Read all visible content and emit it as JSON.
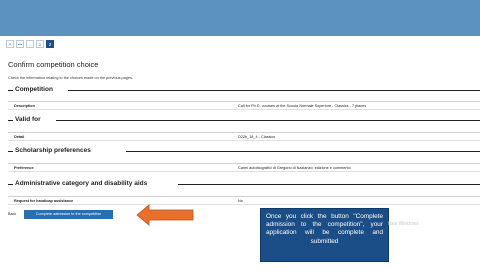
{
  "stepper": {
    "steps": [
      "A",
      "•••",
      "...",
      "1",
      "2"
    ]
  },
  "page": {
    "title": "Confirm competition choice",
    "intro": "Check the information relating to the choices made on the previous pages."
  },
  "sections": {
    "competition": {
      "title": "Competition",
      "rows": [
        {
          "label": "Description",
          "value": "Call for Ph.D. courses at the Scuola Normale Superiore - Classics - 7 places"
        }
      ]
    },
    "valid_for": {
      "title": "Valid for",
      "rows": [
        {
          "label": "Detail",
          "value": "D22b_18_4 - Classics"
        }
      ]
    },
    "scholarship": {
      "title": "Scholarship preferences",
      "rows": [
        {
          "label": "Preference",
          "value": "Carmi autobiografici di Gregorio di Nazianzo: edizione e commento"
        }
      ]
    },
    "administrative": {
      "title": "Administrative category and disability aids",
      "rows": [
        {
          "label": "Request for handicap assistance",
          "value": "No"
        }
      ]
    }
  },
  "buttons": {
    "back": "Back",
    "complete": "Complete admission to the competition"
  },
  "annotation": {
    "text": "Once you click the button \"Complete admission to the competition\", your application will be complete and submitted",
    "arrow_color": "#e8702a",
    "box_color": "#1b4d86"
  },
  "watermark": {
    "text": "ttiva Windows"
  },
  "colors": {
    "topbar": "#5b93c0",
    "primary_button": "#2a6db0",
    "active_step": "#1e4f86"
  }
}
